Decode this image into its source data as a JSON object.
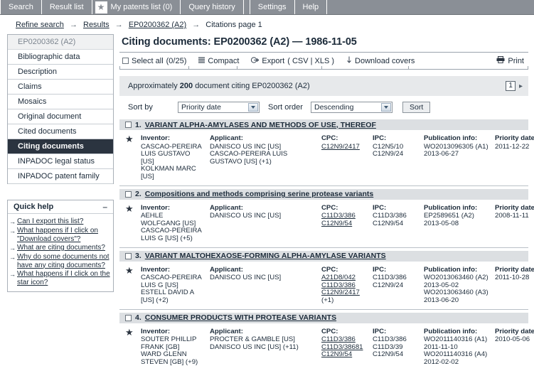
{
  "nav": {
    "tabs": [
      {
        "label": "Search",
        "icon": null
      },
      {
        "label": "Result list",
        "icon": null
      },
      {
        "label": "My patents list (0)",
        "icon": "star-icon"
      },
      {
        "label": "Query history",
        "icon": null
      }
    ],
    "right_tabs": [
      {
        "label": "Settings"
      },
      {
        "label": "Help"
      }
    ]
  },
  "breadcrumb": {
    "items": [
      {
        "label": "Refine search",
        "link": true
      },
      {
        "label": "Results",
        "link": true
      },
      {
        "label": "EP0200362 (A2)",
        "link": true
      },
      {
        "label": "Citations page 1",
        "link": false
      }
    ],
    "separator": "→"
  },
  "sidebar": {
    "header": "EP0200362  (A2)",
    "items": [
      {
        "label": "Bibliographic data",
        "selected": false
      },
      {
        "label": "Description",
        "selected": false
      },
      {
        "label": "Claims",
        "selected": false
      },
      {
        "label": "Mosaics",
        "selected": false
      },
      {
        "label": "Original document",
        "selected": false
      },
      {
        "label": "Cited documents",
        "selected": false
      },
      {
        "label": "Citing documents",
        "selected": true
      },
      {
        "label": "INPADOC legal status",
        "selected": false
      },
      {
        "label": "INPADOC patent family",
        "selected": false
      }
    ],
    "quick_help": {
      "title": "Quick help",
      "collapse_glyph": "–",
      "links": [
        "Can I export this list?",
        "What happens if I click on \"Download covers\"?",
        "What are citing documents?",
        "Why do some documents not have any citing documents?",
        "What happens if I click on the star icon?"
      ]
    }
  },
  "main": {
    "page_title": "Citing documents: EP0200362  (A2) — 1986-11-05",
    "toolbar": {
      "select_all_label": "Select all",
      "select_all_count": "(0/25)",
      "compact_label": "Compact",
      "export_label": "Export",
      "export_formats": "( CSV | XLS )",
      "download_covers_label": "Download covers",
      "print_label": "Print"
    },
    "count_bar": {
      "prefix": "Approximately",
      "count": "200",
      "suffix": "document citing EP0200362 (A2)",
      "page_number": "1",
      "next_glyph": "▸"
    },
    "sort": {
      "sort_by_label": "Sort by",
      "sort_by_value": "Priority date",
      "sort_order_label": "Sort order",
      "sort_order_value": "Descending",
      "sort_button": "Sort"
    },
    "columns": {
      "inventor": "Inventor:",
      "applicant": "Applicant:",
      "cpc": "CPC:",
      "ipc": "IPC:",
      "publication": "Publication info:",
      "priority": "Priority date:"
    },
    "results": [
      {
        "number": "1.",
        "title": "VARIANT ALPHA-AMYLASES AND METHODS OF USE, THEREOF",
        "inventor": [
          "CASCAO-PEREIRA",
          "LUIS GUSTAVO",
          "[US]",
          "KOLKMAN MARC",
          "[US]"
        ],
        "applicant": [
          "DANISCO US INC [US]",
          "CASCAO-PEREIRA LUIS",
          "GUSTAVO [US] (+1)"
        ],
        "cpc": [
          "C12N9/2417"
        ],
        "cpc_more": "",
        "ipc": [
          "C12N5/10",
          "C12N9/24"
        ],
        "publication": [
          "WO2013096305 (A1)",
          "2013-06-27"
        ],
        "priority": "2011-12-22"
      },
      {
        "number": "2.",
        "title": "Compositions and methods comprising serine protease variants",
        "inventor": [
          "AEHLE",
          "WOLFGANG [US]",
          "CASCAO-PEREIRA",
          "LUIS G [US] (+5)"
        ],
        "applicant": [
          "DANISCO US INC [US]"
        ],
        "cpc": [
          "C11D3/386",
          "C12N9/54"
        ],
        "cpc_more": "",
        "ipc": [
          "C11D3/386",
          "C12N9/54"
        ],
        "publication": [
          "EP2589651 (A2)",
          "2013-05-08"
        ],
        "priority": "2008-11-11"
      },
      {
        "number": "3.",
        "title": "VARIANT MALTOHEXAOSE-FORMING ALPHA-AMYLASE VARIANTS",
        "inventor": [
          "CASCAO-PEREIRA",
          "LUIS G [US]",
          "ESTELL DAVID A",
          "[US] (+2)"
        ],
        "applicant": [
          "DANISCO US INC [US]"
        ],
        "cpc": [
          "A21D8/042",
          "C11D3/386",
          "C12N9/2417"
        ],
        "cpc_more": "(+1)",
        "ipc": [
          "C11D3/386",
          "C12N9/24"
        ],
        "publication": [
          "WO2013063460 (A2)",
          "2013-05-02",
          "WO2013063460 (A3)",
          "2013-06-20"
        ],
        "priority": "2011-10-28"
      },
      {
        "number": "4.",
        "title": "CONSUMER PRODUCTS WITH PROTEASE VARIANTS",
        "inventor": [
          "SOUTER PHILLIP",
          "FRANK [GB]",
          "WARD GLENN",
          "STEVEN [GB] (+9)"
        ],
        "applicant": [
          "PROCTER & GAMBLE [US]",
          "DANISCO US INC [US] (+11)"
        ],
        "cpc": [
          "C11D3/386",
          "C11D3/38681",
          "C12N9/54"
        ],
        "cpc_more": "",
        "ipc": [
          "C11D3/386",
          "C11D3/39",
          "C12N9/54"
        ],
        "publication": [
          "WO2011140316 (A1)",
          "2011-11-10",
          "WO2011140316 (A4)",
          "2012-02-02"
        ],
        "priority": "2010-05-06"
      }
    ]
  },
  "colors": {
    "nav_bg": "#8a8f96",
    "selected_item_bg": "#2b3440",
    "result_head_bg": "#dcdfe2",
    "count_bar_bg": "#e7e9eb",
    "text": "#1c2b3a"
  }
}
